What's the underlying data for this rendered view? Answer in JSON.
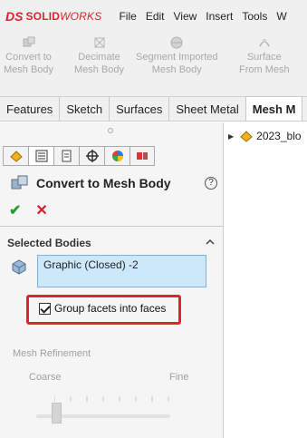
{
  "app": {
    "logo_ds": "DS",
    "logo_brand": "SOLID",
    "logo_brand_italic": "WORKS",
    "brand_color": "#d8262c"
  },
  "menu": [
    "File",
    "Edit",
    "View",
    "Insert",
    "Tools",
    "W"
  ],
  "toolbar": {
    "tools": [
      {
        "line1": "Convert to",
        "line2": "Mesh Body",
        "icon": "mesh-convert-icon"
      },
      {
        "line1": "Decimate",
        "line2": "Mesh Body",
        "icon": "decimate-icon"
      },
      {
        "line1": "Segment Imported",
        "line2": "Mesh Body",
        "icon": "segment-icon"
      },
      {
        "line1": "Surface",
        "line2": "From Mesh",
        "icon": "surface-from-mesh-icon"
      }
    ]
  },
  "tabs": [
    "Features",
    "Sketch",
    "Surfaces",
    "Sheet Metal",
    "Mesh M"
  ],
  "manager_tabs": [
    {
      "icon": "feature-manager-icon"
    },
    {
      "icon": "property-manager-icon",
      "active": true
    },
    {
      "icon": "configuration-manager-icon"
    },
    {
      "icon": "dimxpert-icon"
    },
    {
      "icon": "display-manager-icon"
    },
    {
      "icon": "cam-icon"
    }
  ],
  "property_manager": {
    "title": "Convert to Mesh Body",
    "help": "?",
    "ok": "✔",
    "cancel": "✕",
    "selected_bodies": {
      "title": "Selected Bodies",
      "value": "Graphic (Closed) -2"
    },
    "group_facets": {
      "label": "Group facets into faces",
      "checked": true
    },
    "mesh_refinement": {
      "title": "Mesh Refinement",
      "coarse": "Coarse",
      "fine": "Fine",
      "value": 0
    }
  },
  "tree": {
    "root_label": "2023_blo"
  },
  "colors": {
    "accent_red": "#e8202a",
    "ok_green": "#2c9c2c",
    "selection_blue": "#cde8fb"
  }
}
